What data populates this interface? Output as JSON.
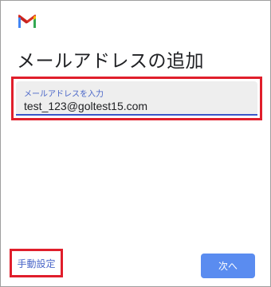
{
  "app": {
    "logo_icon": "gmail-icon",
    "brand_color": "#d93025"
  },
  "header": {
    "title": "メールアドレスの追加"
  },
  "email_input": {
    "label": "メールアドレスを入力",
    "value": "test_123@goltest15.com",
    "underline_color": "#3b55c9"
  },
  "footer": {
    "manual_setup_label": "手動設定",
    "next_label": "次へ",
    "next_color": "#5a8cf0"
  },
  "highlight_color": "#e01e2b"
}
